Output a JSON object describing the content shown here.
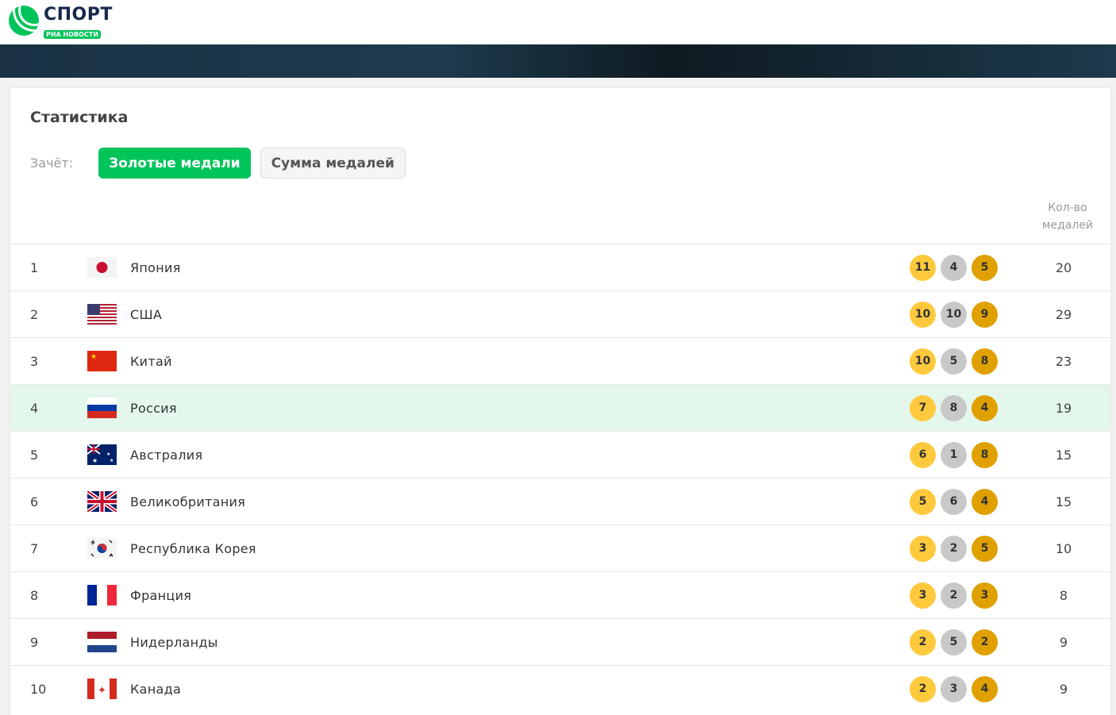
{
  "logo": {
    "title": "СПОРТ",
    "subtitle": "РИА НОВОСТИ"
  },
  "section_title": "Статистика",
  "filter": {
    "label": "Зачёт:",
    "options": [
      "Золотые медали",
      "Сумма медалей"
    ],
    "selected": "Золотые медали"
  },
  "column_header": {
    "line1": "Кол-во",
    "line2": "медалей"
  },
  "colors": {
    "gold": "#fec93d",
    "silver": "#c8c8c8",
    "bronze": "#e0a100",
    "accent": "#00c45a",
    "highlight": "#e3f7ec"
  },
  "rows": [
    {
      "rank": "1",
      "country": "Япония",
      "flag": "jp",
      "gold": "11",
      "silver": "4",
      "bronze": "5",
      "total": "20"
    },
    {
      "rank": "2",
      "country": "США",
      "flag": "us",
      "gold": "10",
      "silver": "10",
      "bronze": "9",
      "total": "29"
    },
    {
      "rank": "3",
      "country": "Китай",
      "flag": "cn",
      "gold": "10",
      "silver": "5",
      "bronze": "8",
      "total": "23"
    },
    {
      "rank": "4",
      "country": "Россия",
      "flag": "ru",
      "gold": "7",
      "silver": "8",
      "bronze": "4",
      "total": "19",
      "highlighted": true
    },
    {
      "rank": "5",
      "country": "Австралия",
      "flag": "au",
      "gold": "6",
      "silver": "1",
      "bronze": "8",
      "total": "15"
    },
    {
      "rank": "6",
      "country": "Великобритания",
      "flag": "gb",
      "gold": "5",
      "silver": "6",
      "bronze": "4",
      "total": "15"
    },
    {
      "rank": "7",
      "country": "Республика Корея",
      "flag": "kr",
      "gold": "3",
      "silver": "2",
      "bronze": "5",
      "total": "10"
    },
    {
      "rank": "8",
      "country": "Франция",
      "flag": "fr",
      "gold": "3",
      "silver": "2",
      "bronze": "3",
      "total": "8"
    },
    {
      "rank": "9",
      "country": "Нидерланды",
      "flag": "nl",
      "gold": "2",
      "silver": "5",
      "bronze": "2",
      "total": "9"
    },
    {
      "rank": "10",
      "country": "Канада",
      "flag": "ca",
      "gold": "2",
      "silver": "3",
      "bronze": "4",
      "total": "9"
    }
  ]
}
